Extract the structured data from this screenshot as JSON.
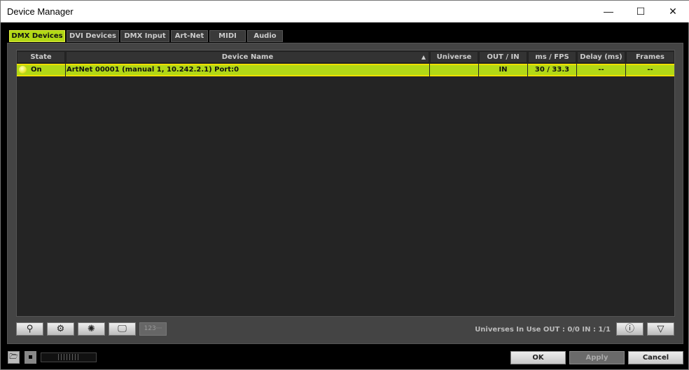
{
  "window": {
    "title": "Device Manager",
    "minimize": "—",
    "maximize": "☐",
    "close": "✕"
  },
  "tabs": [
    {
      "label": "DMX Devices",
      "active": true
    },
    {
      "label": "DVI Devices"
    },
    {
      "label": "DMX Input"
    },
    {
      "label": "Art-Net"
    },
    {
      "label": "MIDI"
    },
    {
      "label": "Audio"
    }
  ],
  "table": {
    "columns": [
      "State",
      "Device Name",
      "Universe",
      "OUT / IN",
      "ms / FPS",
      "Delay (ms)",
      "Frames"
    ],
    "sort_indicator": "▲",
    "rows": [
      {
        "state": "On",
        "device_name": "ArtNet 00001 (manual 1, 10.242.2.1) Port:0",
        "universe": "",
        "out_in": "IN",
        "ms_fps": "30 / 33.3",
        "delay": "--",
        "frames": "--"
      }
    ]
  },
  "toolbar": {
    "search": "⚲",
    "settings": "⚙",
    "light": "✺",
    "monitor": "🖵",
    "numbers": "123···",
    "info": "ⓘ",
    "filter": "▽"
  },
  "status": "Universes In Use OUT : 0/0  IN : 1/1",
  "footer": {
    "open": "🗁",
    "save": "▪",
    "slider": "||||||||",
    "ok": "OK",
    "apply": "Apply",
    "cancel": "Cancel"
  },
  "colors": {
    "accent": "#b2d816",
    "highlight_border": "#f0e000"
  }
}
